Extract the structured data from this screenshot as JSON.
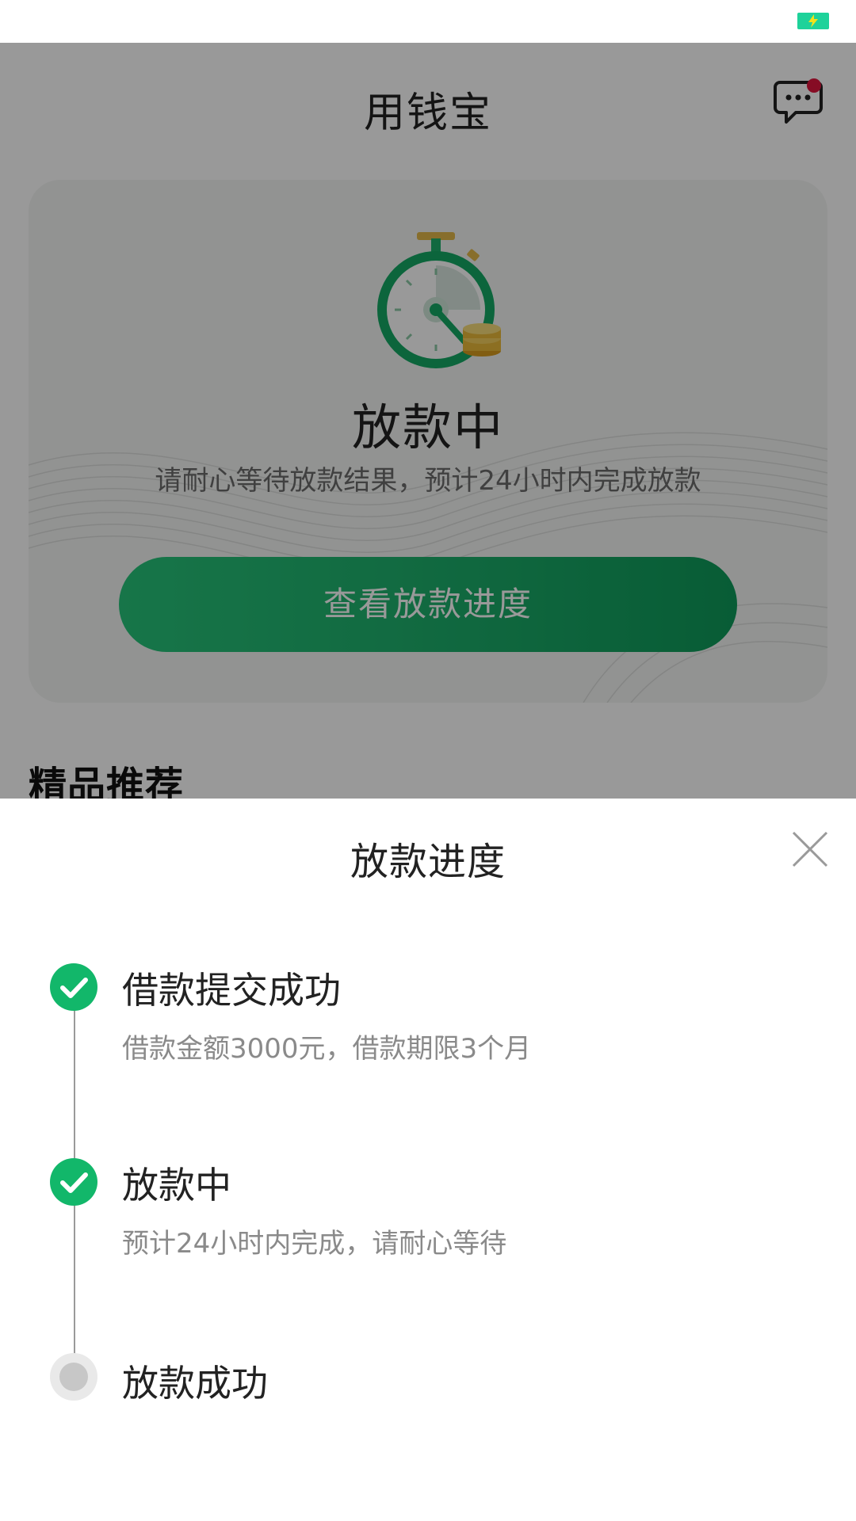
{
  "app": {
    "title": "用钱宝",
    "status_card": {
      "status": "放款中",
      "description": "请耐心等待放款结果，预计24小时内完成放款",
      "button_label": "查看放款进度"
    },
    "section_title": "精品推荐"
  },
  "sheet": {
    "title": "放款进度",
    "steps": [
      {
        "title": "借款提交成功",
        "subtitle": "借款金额3000元，借款期限3个月",
        "state": "done"
      },
      {
        "title": "放款中",
        "subtitle": "预计24小时内完成，请耐心等待",
        "state": "done"
      },
      {
        "title": "放款成功",
        "subtitle": "",
        "state": "pending"
      }
    ]
  },
  "icons": {
    "battery": "battery-charging-icon",
    "message": "message-icon",
    "close": "close-icon",
    "check": "check-icon",
    "timer": "stopwatch-coins-icon"
  },
  "colors": {
    "accent": "#12b76a",
    "button_gradient_start": "#27c47a",
    "button_gradient_end": "#0e9a5a",
    "notification_dot": "#e0143c",
    "battery": "#1ed29a"
  }
}
